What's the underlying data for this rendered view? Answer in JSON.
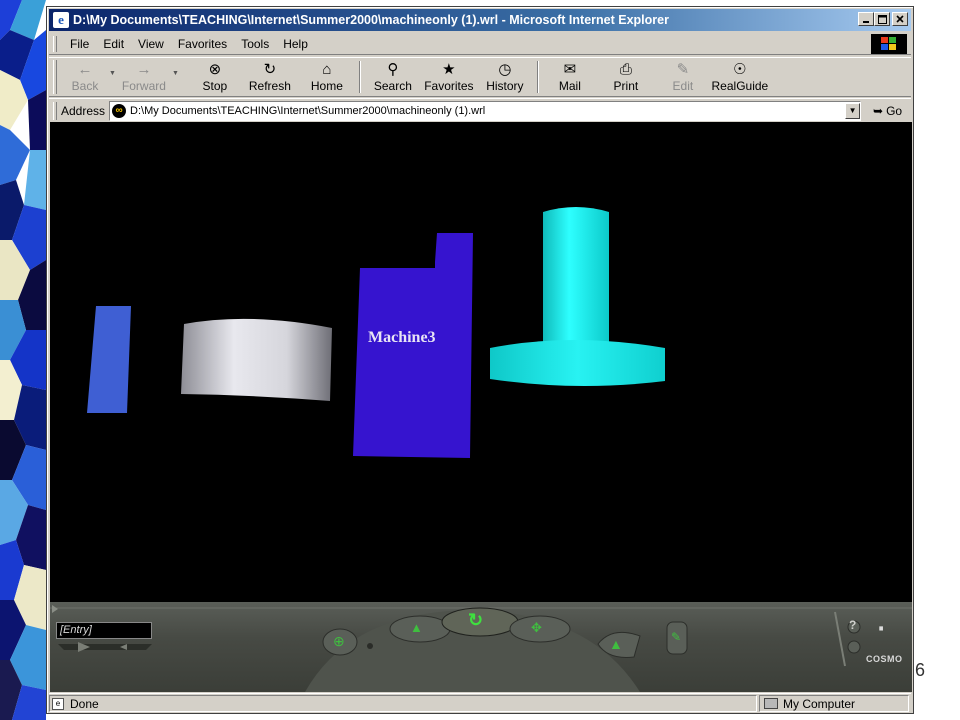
{
  "window": {
    "title": "D:\\My Documents\\TEACHING\\Internet\\Summer2000\\machineonly (1).wrl - Microsoft Internet Explorer"
  },
  "menu": {
    "items": [
      {
        "label": "File"
      },
      {
        "label": "Edit"
      },
      {
        "label": "View"
      },
      {
        "label": "Favorites"
      },
      {
        "label": "Tools"
      },
      {
        "label": "Help"
      }
    ]
  },
  "toolbar": {
    "back": "Back",
    "forward": "Forward",
    "stop": "Stop",
    "refresh": "Refresh",
    "home": "Home",
    "search": "Search",
    "favorites": "Favorites",
    "history": "History",
    "mail": "Mail",
    "print": "Print",
    "edit": "Edit",
    "realguide": "RealGuide"
  },
  "address": {
    "label": "Address",
    "url": "D:\\My Documents\\TEACHING\\Internet\\Summer2000\\machineonly (1).wrl",
    "go": "Go"
  },
  "scene": {
    "label_text": "Machine3",
    "colors": {
      "background": "#000000",
      "blue_panel": "#3f5fd3",
      "machine_box": "#3614cf",
      "cyan_part": "#15e5e5",
      "gray_cylinder": "#c0c0c8"
    }
  },
  "cosmo": {
    "entry": "[Entry]",
    "brand": "COSMO",
    "help": "?"
  },
  "status": {
    "text": "Done",
    "zone": "My Computer"
  },
  "slide": {
    "number": "6"
  }
}
